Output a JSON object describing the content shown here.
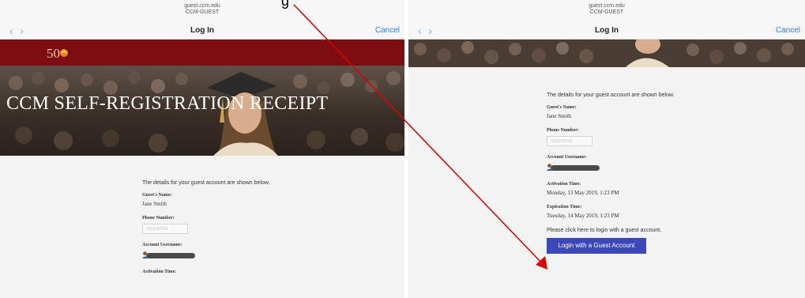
{
  "browser": {
    "host": "guest.ccm.edu",
    "ssid": "CCM-GUEST",
    "title": "Log In",
    "cancel": "Cancel",
    "back_glyph": "‹",
    "forward_glyph": "›"
  },
  "header": {
    "logo_text": "50",
    "banner_title": "CCM SELF-REGISTRATION RECEIPT"
  },
  "receipt": {
    "intro": "The details for your guest account are shown below.",
    "guest_name_label": "Guest's Name:",
    "guest_name": "Jane Smith",
    "phone_label": "Phone Number:",
    "phone_value": "2015550781",
    "username_label": "Account Username:",
    "activation_label": "Activation Time:",
    "activation_value": "Monday, 13 May 2019, 1:23 PM",
    "expiration_label": "Expiration Time:",
    "expiration_value": "Tuesday, 14 May 2019, 1:23 PM",
    "cta_text": "Please click here to login with a guest account.",
    "login_button": "Login with a Guest Account"
  },
  "annotation": {
    "label_fragment": "g",
    "arrow_color": "#e00000"
  }
}
